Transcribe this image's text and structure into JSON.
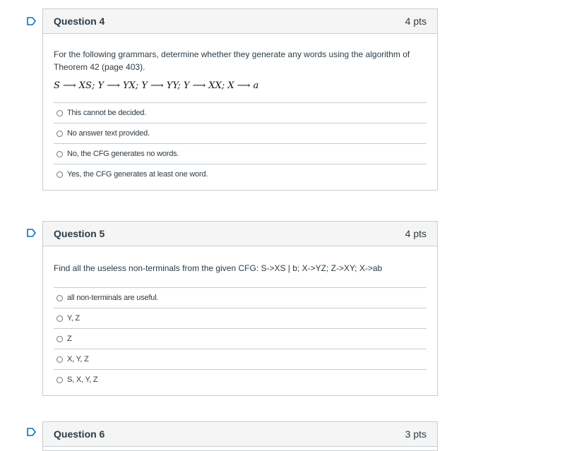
{
  "questions": [
    {
      "title": "Question 4",
      "points": "4 pts",
      "text": "For the following grammars, determine whether they generate any words using the algorithm of Theorem 42 (page 403).",
      "formula": "S ⟶ XS;  Y ⟶ YX;  Y ⟶ YY;  Y ⟶ XX;  X ⟶ a",
      "answers": [
        "This cannot be decided.",
        "No answer text provided.",
        "No, the CFG generates no words.",
        "Yes, the CFG generates at least one word."
      ]
    },
    {
      "title": "Question 5",
      "points": "4 pts",
      "text": "Find all the useless non-terminals from the given CFG: S->XS | b; X->YZ; Z->XY; X->ab",
      "answers": [
        "all non-terminals are useful.",
        "Y, Z",
        "Z",
        "X, Y, Z",
        "S, X, Y, Z"
      ]
    },
    {
      "title": "Question 6",
      "points": "3 pts"
    }
  ],
  "colors": {
    "flag": "#0374b5",
    "border": "#c7cdd1",
    "header_bg": "#f5f5f5"
  },
  "icons": {
    "flag": "flag-icon",
    "radio": "radio-icon"
  }
}
